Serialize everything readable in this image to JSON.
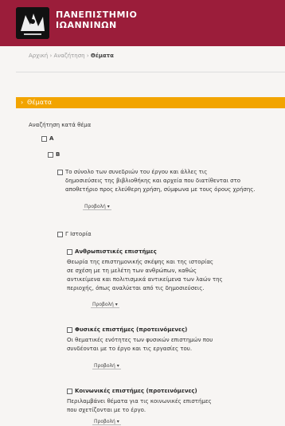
{
  "header": {
    "brand_line1": "ΠΑΝΕΠΙΣΤΗΜΙΟ",
    "brand_line2": "ΙΩΑΝΝΙΝΩΝ"
  },
  "breadcrumb": {
    "item1": "Αρχική",
    "sep1": "›",
    "item2": "Αναζήτηση",
    "sep2": "›",
    "current": "Θέματα"
  },
  "section_bar": {
    "label": "Θέματα"
  },
  "tree": {
    "root_label": "Αναζήτηση κατά θέμα",
    "node_a": "Α",
    "node_b": "Β",
    "desc1_line1": "Το σύνολο των συνεδριών του έργου και άλλες τις",
    "desc1_line2": "δημοσιεύσεις της βιβλιοθήκης και αρχεία που διατίθενται στο",
    "desc1_line3": "αποθετήριο προς ελεύθερη χρήση, σύμφωνα με τους όρους χρήσης.",
    "more1": "Προβολή",
    "node_c": "Γ",
    "node_c_label": "Ιστορία",
    "sub1_title": "Ανθρωπιστικές επιστήμες",
    "sub1_line1": "Θεωρία της επιστημονικής σκέψης και της ιστορίας",
    "sub1_line2": "σε σχέση με τη μελέτη των ανθρώπων, καθώς",
    "sub1_line3": "αντικείμενα και πολιτισμικά αντικείμενα των λαών της",
    "sub1_line4": "περιοχής, όπως αναλύεται από τις δημοσιεύσεις.",
    "more2": "Προβολή",
    "sub2_title": "Φυσικές επιστήμες (προτεινόμενες)",
    "sub2_line1": "Οι θεματικές ενότητες των φυσικών επιστημών που",
    "sub2_line2": "συνδέονται με το έργο και τις εργασίες του.",
    "more3": "Προβολή",
    "sub3_title": "Κοινωνικές επιστήμες (προτεινόμενες)",
    "sub3_line1": "Περιλαμβάνει θέματα για τις κοινωνικές επιστήμες",
    "sub3_line2": "που σχετίζονται με το έργο.",
    "more4": "Προβολή"
  }
}
